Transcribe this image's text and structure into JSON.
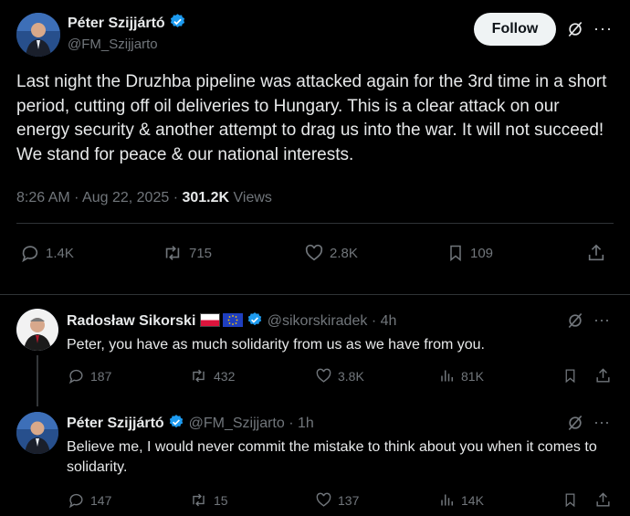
{
  "main_tweet": {
    "author_name": "Péter Szijjártó",
    "handle": "@FM_Szijjarto",
    "follow_label": "Follow",
    "text": "Last night the Druzhba pipeline was attacked again for the 3rd time in a short period, cutting off oil deliveries to Hungary. This is a clear attack on our energy security & another attempt to drag us into the war. It will not succeed! We stand for peace & our national interests.",
    "time": "8:26 AM",
    "date": "Aug 22, 2025",
    "views_count": "301.2K",
    "views_label": "Views",
    "replies": "1.4K",
    "reposts": "715",
    "likes": "2.8K",
    "bookmarks": "109"
  },
  "reply_1": {
    "author_name": "Radosław Sikorski",
    "handle": "@sikorskiradek",
    "time_ago": "4h",
    "text": "Peter, you have as much solidarity from us as we have from you.",
    "replies": "187",
    "reposts": "432",
    "likes": "3.8K",
    "views": "81K"
  },
  "reply_2": {
    "author_name": "Péter Szijjártó",
    "handle": "@FM_Szijjarto",
    "time_ago": "1h",
    "text": "Believe me, I would never commit the mistake to think about you when it comes to solidarity.",
    "replies": "147",
    "reposts": "15",
    "likes": "137",
    "views": "14K"
  },
  "colors": {
    "background": "#000000",
    "text": "#e7e9ea",
    "muted": "#71767b",
    "verified": "#1d9bf0",
    "divider": "#2f3336"
  },
  "separator": "·"
}
